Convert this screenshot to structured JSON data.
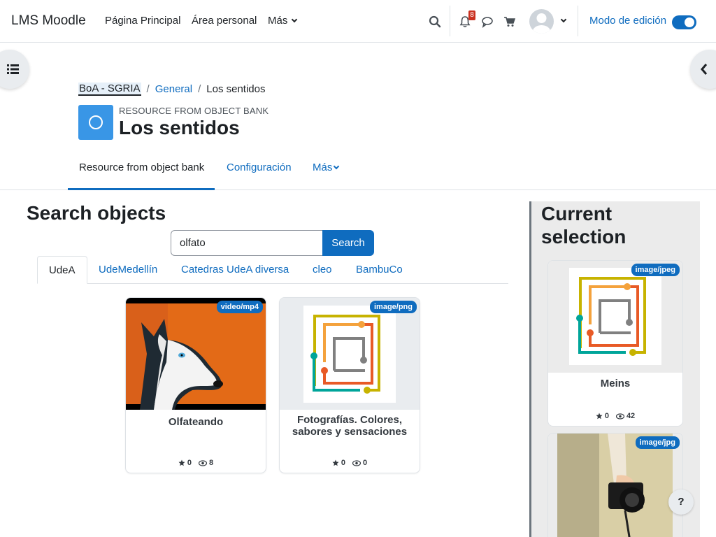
{
  "navbar": {
    "brand": "LMS Moodle",
    "links": [
      "Página Principal",
      "Área personal"
    ],
    "more_label": "Más",
    "notification_count": "8",
    "edit_mode_label": "Modo de edición",
    "edit_mode_on": true,
    "icons": [
      "search-icon",
      "bell-icon",
      "chat-icon",
      "cart-icon",
      "avatar",
      "chevron-down-icon"
    ]
  },
  "breadcrumb": [
    "BoA - SGRIA",
    "General",
    "Los sentidos"
  ],
  "header": {
    "module_type": "RESOURCE FROM OBJECT BANK",
    "title": "Los sentidos"
  },
  "secondary_nav": {
    "items": [
      "Resource from object bank",
      "Configuración"
    ],
    "more_label": "Más"
  },
  "search": {
    "title": "Search objects",
    "query": "olfato",
    "button_label": "Search"
  },
  "tabs": [
    "UdeA",
    "UdeMedellín",
    "Catedras UdeA diversa",
    "cleo",
    "BambuCo"
  ],
  "results": [
    {
      "mime": "video/mp4",
      "name": "Olfateando",
      "stars": "0",
      "views": "8"
    },
    {
      "mime": "image/png",
      "name": "Fotografías. Colores, sabores y sensaciones",
      "stars": "0",
      "views": "0"
    }
  ],
  "selection": {
    "title": "Current selection",
    "items": [
      {
        "mime": "image/jpeg",
        "name": "Meins",
        "stars": "0",
        "views": "42"
      },
      {
        "mime": "image/jpg",
        "name": "",
        "stars": "",
        "views": ""
      }
    ]
  },
  "help_label": "?",
  "colors": {
    "primary": "#0f6cbf",
    "module_icon": "#3996e6",
    "badge": "#ca3120"
  }
}
